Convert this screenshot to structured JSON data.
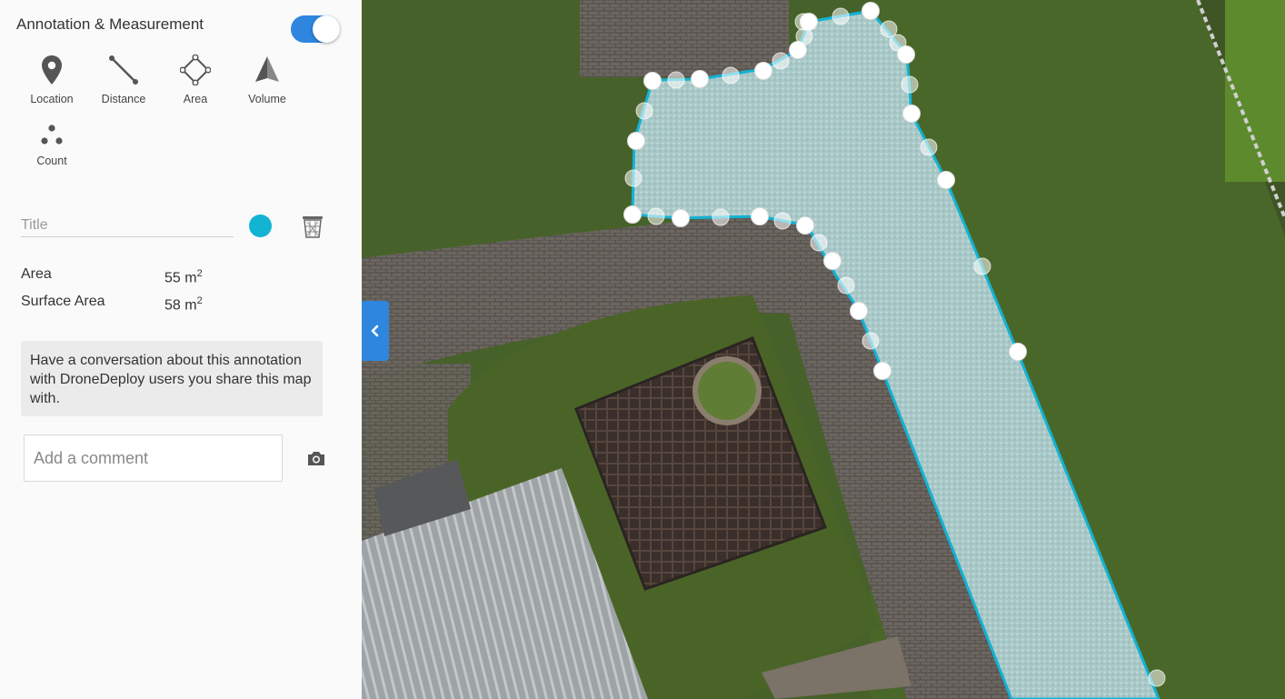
{
  "panel": {
    "title": "Annotation & Measurement",
    "toggle_on": true,
    "accent_color": "#2e86de"
  },
  "tools": [
    {
      "label": "Location",
      "icon": "location-pin-icon"
    },
    {
      "label": "Distance",
      "icon": "ruler-line-icon"
    },
    {
      "label": "Area",
      "icon": "polygon-area-icon"
    },
    {
      "label": "Volume",
      "icon": "pyramid-volume-icon"
    },
    {
      "label": "Count",
      "icon": "count-dots-icon"
    }
  ],
  "annotation": {
    "title_placeholder": "Title",
    "title_value": "",
    "color": "#12b3d3"
  },
  "measurements": {
    "area_label": "Area",
    "area_value": "55 m",
    "surface_label": "Surface Area",
    "surface_value": "58 m",
    "unit_exponent": "2"
  },
  "info": {
    "text": "Have a conversation about this annotation with DroneDeploy users you share this map with."
  },
  "comment": {
    "placeholder": "Add a comment",
    "value": ""
  },
  "map": {
    "outline_color": "#12b3d3"
  }
}
